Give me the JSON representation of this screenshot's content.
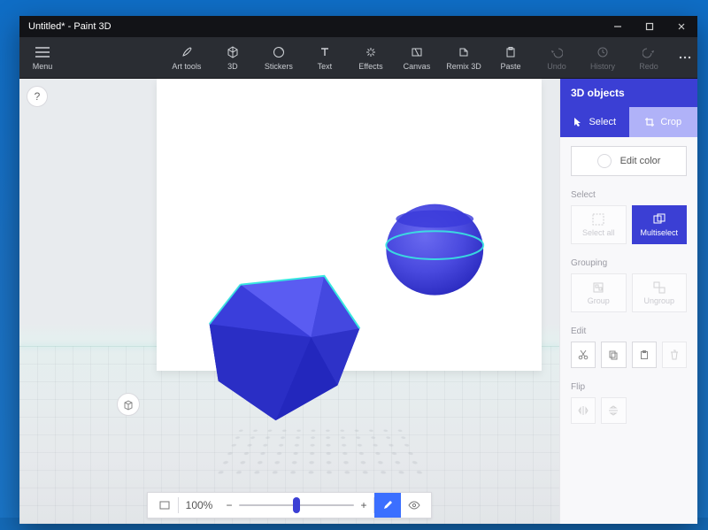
{
  "window": {
    "title": "Untitled* - Paint 3D"
  },
  "toolbar": {
    "menu": "Menu",
    "art_tools": "Art tools",
    "three_d": "3D",
    "stickers": "Stickers",
    "text": "Text",
    "effects": "Effects",
    "canvas": "Canvas",
    "remix_3d": "Remix 3D",
    "paste": "Paste",
    "undo": "Undo",
    "history": "History",
    "redo": "Redo"
  },
  "zoom": {
    "value": "100%",
    "slider_percent": 50
  },
  "sidepanel": {
    "header": "3D objects",
    "mode_select": "Select",
    "mode_crop": "Crop",
    "edit_color": "Edit color",
    "section_select": "Select",
    "select_all": "Select all",
    "multiselect": "Multiselect",
    "section_grouping": "Grouping",
    "group": "Group",
    "ungroup": "Ungroup",
    "section_edit": "Edit",
    "section_flip": "Flip"
  },
  "help_tooltip": "?"
}
